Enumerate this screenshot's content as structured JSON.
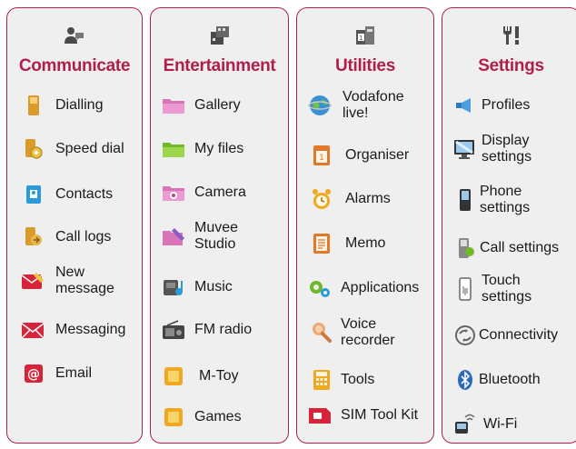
{
  "columns": [
    {
      "id": "communicate",
      "title": "Communicate",
      "items": [
        {
          "label": "Dialling",
          "icon": "phone-icon"
        },
        {
          "label": "Speed dial",
          "icon": "speed-dial-icon"
        },
        {
          "label": "Contacts",
          "icon": "contacts-icon"
        },
        {
          "label": "Call logs",
          "icon": "call-logs-icon"
        },
        {
          "label": "New message",
          "icon": "new-message-icon"
        },
        {
          "label": "Messaging",
          "icon": "messaging-icon"
        },
        {
          "label": "Email",
          "icon": "email-icon"
        }
      ]
    },
    {
      "id": "entertainment",
      "title": "Entertainment",
      "items": [
        {
          "label": "Gallery",
          "icon": "folder-pink-icon"
        },
        {
          "label": "My files",
          "icon": "folder-green-icon"
        },
        {
          "label": "Camera",
          "icon": "camera-folder-icon"
        },
        {
          "label": "Muvee Studio",
          "icon": "muvee-icon"
        },
        {
          "label": "Music",
          "icon": "music-icon"
        },
        {
          "label": "FM radio",
          "icon": "radio-icon"
        },
        {
          "label": "M-Toy",
          "icon": "m-toy-icon"
        },
        {
          "label": "Games",
          "icon": "games-icon"
        }
      ]
    },
    {
      "id": "utilities",
      "title": "Utilities",
      "items": [
        {
          "label": "Vodafone live!",
          "icon": "globe-icon"
        },
        {
          "label": "Organiser",
          "icon": "calendar-icon"
        },
        {
          "label": "Alarms",
          "icon": "alarm-clock-icon"
        },
        {
          "label": "Memo",
          "icon": "memo-icon"
        },
        {
          "label": "Applications",
          "icon": "gears-icon"
        },
        {
          "label": "Voice recorder",
          "icon": "microphone-icon"
        },
        {
          "label": "Tools",
          "icon": "calculator-icon"
        },
        {
          "label": "SIM Tool Kit",
          "icon": "sim-card-icon"
        }
      ]
    },
    {
      "id": "settings",
      "title": "Settings",
      "items": [
        {
          "label": "Profiles",
          "icon": "speaker-icon"
        },
        {
          "label": "Display settings",
          "icon": "display-icon"
        },
        {
          "label": "Phone settings",
          "icon": "phone-settings-icon"
        },
        {
          "label": "Call settings",
          "icon": "call-settings-icon"
        },
        {
          "label": "Touch settings",
          "icon": "touch-icon"
        },
        {
          "label": "Connectivity",
          "icon": "connectivity-icon"
        },
        {
          "label": "Bluetooth",
          "icon": "bluetooth-icon"
        },
        {
          "label": "Wi-Fi",
          "icon": "wifi-icon"
        }
      ]
    }
  ],
  "colors": {
    "accent": "#b01f4a",
    "panel_bg": "#efefef"
  }
}
